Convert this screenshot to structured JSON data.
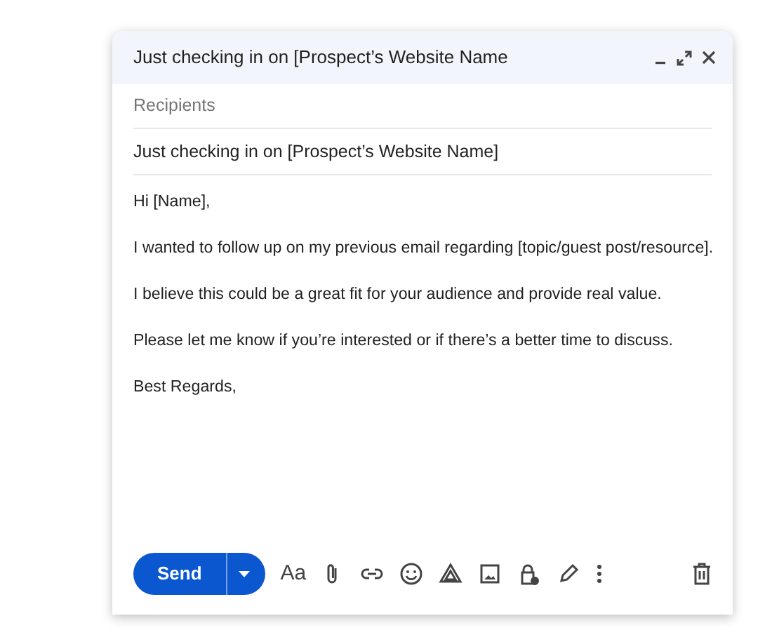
{
  "window": {
    "title": "Just checking in on [Prospect’s Website Name"
  },
  "recipients": {
    "placeholder": "Recipients"
  },
  "subject": {
    "value": "Just checking in on [Prospect’s Website Name]"
  },
  "body": [
    "Hi [Name],",
    "I wanted to follow up on my previous email regarding [topic/guest post/resource].",
    "I believe this could be a great fit for your audience and provide real value.",
    "Please let me know if you’re interested or if there’s a better time to discuss.",
    "Best Regards,"
  ],
  "toolbar": {
    "send": "Send",
    "format": "Aa"
  }
}
